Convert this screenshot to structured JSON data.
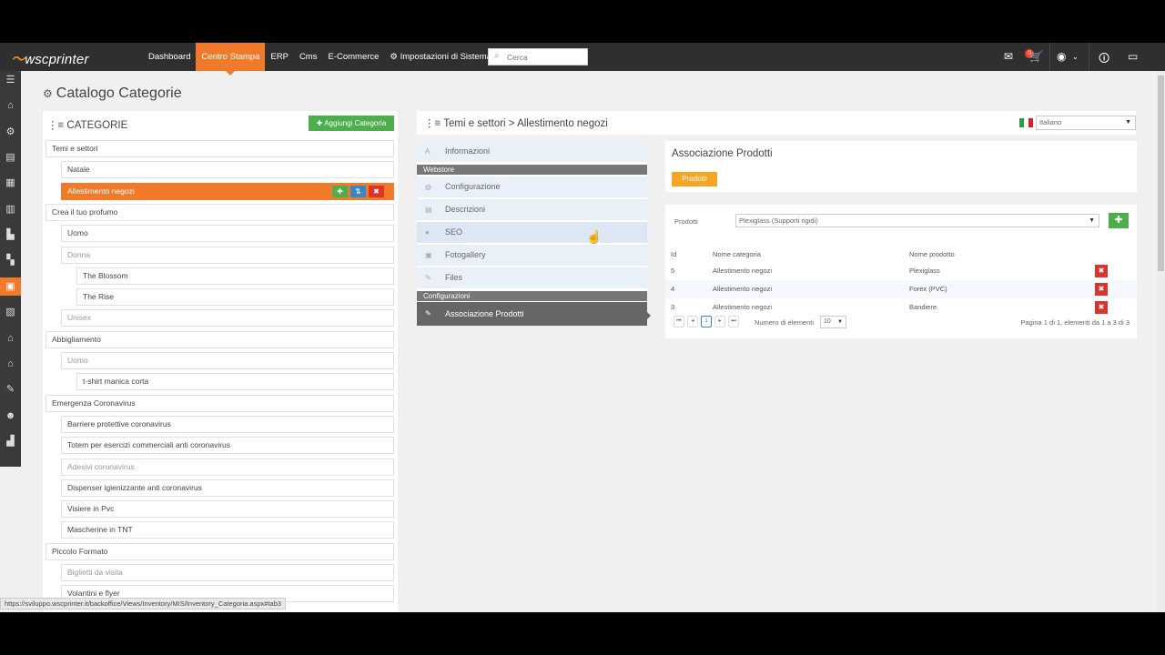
{
  "topbar": {
    "logo": "wscprinter",
    "nav": [
      "Dashboard",
      "Centro Stampa",
      "ERP",
      "Cms",
      "E-Commerce",
      "Impostazioni di Sistema"
    ],
    "active_nav": "Centro Stampa",
    "search_placeholder": "Cerca",
    "notification_count": "0"
  },
  "page": {
    "title": "Catalogo Categorie"
  },
  "categories": {
    "header": "CATEGORIE",
    "add_button": "Aggiungi Categoria",
    "rows": [
      {
        "label": "Temi e settori",
        "level": 0
      },
      {
        "label": "Natale",
        "level": 1
      },
      {
        "label": "Allestimento negozi",
        "level": 1,
        "selected": true
      },
      {
        "label": "Crea il tuo profumo",
        "level": 0
      },
      {
        "label": "Uomo",
        "level": 1
      },
      {
        "label": "Donna",
        "level": 1,
        "muted": true
      },
      {
        "label": "The Blossom",
        "level": 2
      },
      {
        "label": "The Rise",
        "level": 2
      },
      {
        "label": "Unisex",
        "level": 1,
        "muted": true
      },
      {
        "label": "Abbigliamento",
        "level": 0
      },
      {
        "label": "Uomo",
        "level": 1,
        "muted": true
      },
      {
        "label": "t-shirt manica corta",
        "level": 2
      },
      {
        "label": "Emergenza Coronavirus",
        "level": 0
      },
      {
        "label": "Barriere protettive coronavirus",
        "level": 1
      },
      {
        "label": "Totem per esercizi commerciali anti coronavirus",
        "level": 1
      },
      {
        "label": "Adesivi coronavirus",
        "level": 1,
        "muted": true
      },
      {
        "label": "Dispenser igienizzante anti coronavirus",
        "level": 1
      },
      {
        "label": "Visiere in Pvc",
        "level": 1
      },
      {
        "label": "Mascherine in TNT",
        "level": 1
      },
      {
        "label": "Piccolo Formato",
        "level": 0
      },
      {
        "label": "Biglietti da visita",
        "level": 1,
        "muted": true
      },
      {
        "label": "Volantini e flyer",
        "level": 1
      }
    ]
  },
  "breadcrumb": "Temi e settori > Allestimento negozi",
  "language": {
    "selected": "Italiano"
  },
  "side_menu": {
    "informazioni": "Informazioni",
    "section_webstore": "Webstore",
    "configurazione": "Configurazione",
    "descrizioni": "Descrizioni",
    "seo": "SEO",
    "fotogallery": "Fotogallery",
    "files": "Files",
    "section_configurazioni": "Configurazioni",
    "associazione": "Associazione Prodotti"
  },
  "association": {
    "title": "Associazione Prodotti",
    "tab": "Prodotti",
    "field_label": "Prodotti",
    "field_value": "Plexiglass (Supporti rigidi)",
    "columns": {
      "id": "Id",
      "categoria": "Nome categoria",
      "prodotto": "Nome prodotto"
    },
    "rows": [
      {
        "id": "5",
        "categoria": "Allestimento negozi",
        "prodotto": "Plexiglass"
      },
      {
        "id": "4",
        "categoria": "Allestimento negozi",
        "prodotto": "Forex (PVC)"
      },
      {
        "id": "3",
        "categoria": "Allestimento negozi",
        "prodotto": "Bandiere"
      }
    ],
    "page_current": "1",
    "num_label": "Numero di elementi",
    "num_value": "10",
    "page_info": "Pagina 1 di 1, elementi da 1 a 3 di 3"
  },
  "status_url": "https://sviluppo.wscprinter.it/backoffice/Views/Inventory/MIS/Inventory_Categoria.aspx#tab3",
  "colors": {
    "accent": "#f07a2a",
    "topbar": "#2f2f2f",
    "success": "#4cae4c",
    "danger": "#d9352a",
    "warning": "#f5a623"
  }
}
